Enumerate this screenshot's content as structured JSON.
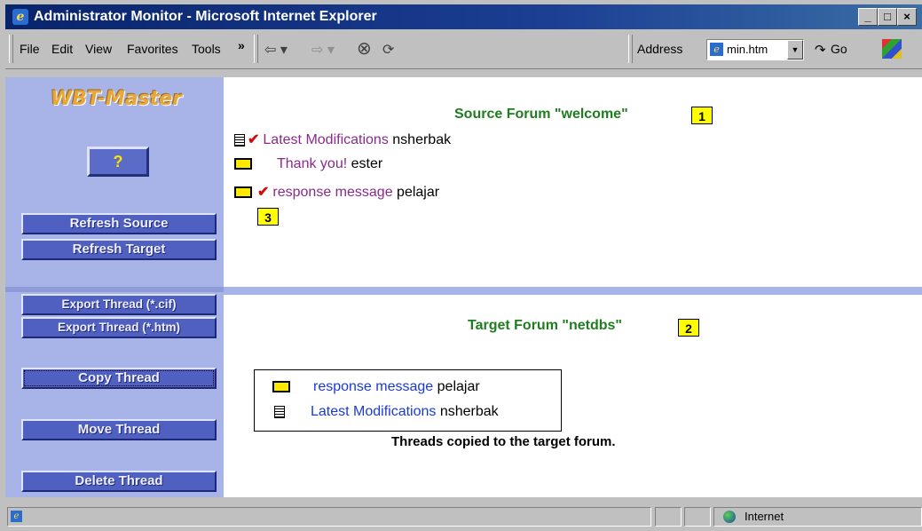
{
  "window": {
    "title": "Administrator Monitor - Microsoft Internet Explorer",
    "buttons": {
      "minimize": "_",
      "restore": "□",
      "close": "×"
    }
  },
  "menu": {
    "items": [
      "File",
      "Edit",
      "View",
      "Favorites",
      "Tools"
    ],
    "more": "»"
  },
  "toolbar": {
    "back": "⇦ ▾",
    "forward": "⇨ ▾",
    "stop": "⊗",
    "refresh": "⟳",
    "address_label": "Address",
    "address_value": "min.htm",
    "go_label": "Go"
  },
  "sidebar": {
    "logo": "WBT-Master",
    "help_label": "?",
    "buttons": {
      "refresh_source": "Refresh Source",
      "refresh_target": "Refresh Target",
      "export_cif": "Export Thread (*.cif)",
      "export_htm": "Export Thread (*.htm)",
      "copy": "Copy Thread",
      "move": "Move Thread",
      "delete": "Delete Thread"
    }
  },
  "source": {
    "title": "Source Forum \"welcome\"",
    "callout": "1",
    "callout3": "3",
    "threads": [
      {
        "type": "doc",
        "checked": true,
        "title": "Latest Modifications",
        "author": "nsherbak"
      },
      {
        "type": "folder",
        "checked": false,
        "title": "Thank you!",
        "author": "ester"
      },
      {
        "type": "folder",
        "checked": true,
        "title": "response message",
        "author": "pelajar"
      }
    ]
  },
  "target": {
    "title": "Target Forum \"netdbs\"",
    "callout": "2",
    "threads": [
      {
        "type": "folder",
        "title": "response message",
        "author": "pelajar"
      },
      {
        "type": "doc",
        "title": "Latest Modifications",
        "author": "nsherbak"
      }
    ],
    "message": "Threads copied to the target forum."
  },
  "status": {
    "zone": "Internet"
  },
  "colors": {
    "sidebar": "#a8b4e8",
    "forum_title": "#1e7e1e",
    "visited_link": "#8a2a8a",
    "link": "#1a3ad8",
    "callout": "#ffff00"
  }
}
